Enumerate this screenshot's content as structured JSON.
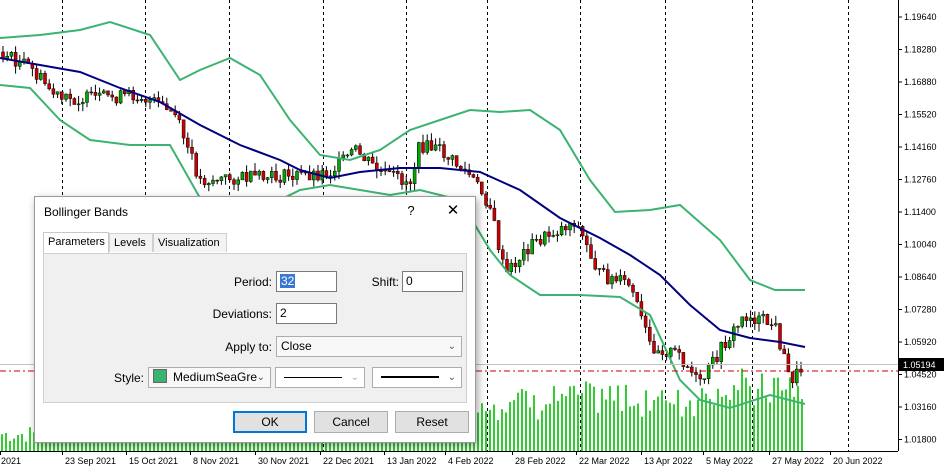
{
  "chart": {
    "colors": {
      "bg": "#ffffff",
      "bull": "#00a800",
      "bear": "#cc0000",
      "wick": "#000000",
      "bands": "#3cb371",
      "middle": "#000080",
      "volume": "#32cd32",
      "current_price_line": "#cc0000"
    },
    "price_axis": [
      "1.19640",
      "1.18280",
      "1.16880",
      "1.15520",
      "1.14160",
      "1.12760",
      "1.11400",
      "1.10040",
      "1.08640",
      "1.07280",
      "1.05920",
      "1.04520",
      "1.03160",
      "1.01800"
    ],
    "current_price": "1.05194",
    "date_axis": [
      "2021",
      "23 Sep 2021",
      "15 Oct 2021",
      "8 Nov 2021",
      "30 Nov 2021",
      "22 Dec 2021",
      "13 Jan 2022",
      "4 Feb 2022",
      "28 Feb 2022",
      "22 Mar 2022",
      "13 Apr 2022",
      "5 May 2022",
      "27 May 2022",
      "20 Jun 2022"
    ]
  },
  "dialog": {
    "title": "Bollinger Bands",
    "help_glyph": "?",
    "close_glyph": "✕",
    "tabs": [
      {
        "label": "Parameters"
      },
      {
        "label": "Levels"
      },
      {
        "label": "Visualization"
      }
    ],
    "period_label": "Period:",
    "period_value": "32",
    "shift_label": "Shift:",
    "shift_value": "0",
    "deviations_label": "Deviations:",
    "deviations_value": "2",
    "apply_label": "Apply to:",
    "apply_value": "Close",
    "style_label": "Style:",
    "style_color_name": "MediumSeaGre",
    "style_color": "#3cb371",
    "ok_label": "OK",
    "cancel_label": "Cancel",
    "reset_label": "Reset"
  }
}
